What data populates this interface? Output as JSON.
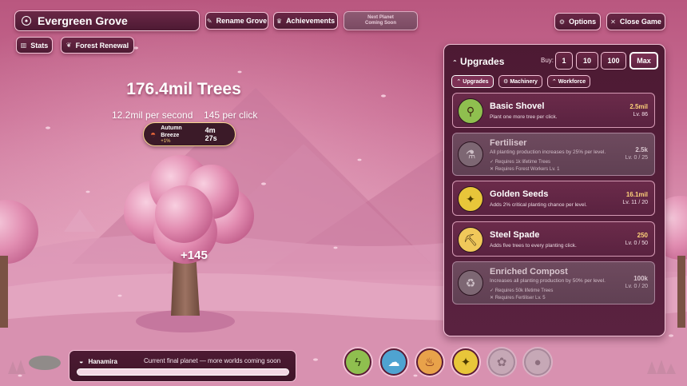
{
  "header": {
    "grove_name": "Evergreen Grove",
    "rename_label": "Rename Grove",
    "achievements_label": "Achievements",
    "next_planet_line1": "Next Planet",
    "next_planet_line2": "Coming Soon",
    "stats_label": "Stats",
    "renewal_label": "Forest Renewal",
    "options_label": "Options",
    "close_label": "Close Game"
  },
  "main": {
    "tree_count": "176.4mil Trees",
    "per_second": "12.2mil per second",
    "per_click": "145 per click",
    "click_popup": "+145"
  },
  "event": {
    "name": "Autumn Breeze",
    "bonus": "+1%",
    "timer": "4m 27s"
  },
  "upgrades_panel": {
    "title": "Upgrades",
    "buy_label": "Buy:",
    "buy_options": [
      "1",
      "10",
      "100",
      "Max"
    ],
    "selected_buy": "Max",
    "tabs": [
      "Upgrades",
      "Machinery",
      "Workforce"
    ],
    "active_tab": "Upgrades",
    "items": [
      {
        "name": "Basic Shovel",
        "desc": "Plant one more tree per click.",
        "cost": "2.5mil",
        "level": "Lv. 86",
        "locked": false,
        "icon": "shovel-icon",
        "icon_color": "#8fbf4f"
      },
      {
        "name": "Fertiliser",
        "desc": "All planting production increases by 25% per level.",
        "req1": "✓ Requires 1k lifetime Trees",
        "req2": "✕ Requires Forest Workers Lv. 1",
        "cost": "2.5k",
        "level": "Lv. 0 / 25",
        "locked": true,
        "icon": "test-tube-icon"
      },
      {
        "name": "Golden Seeds",
        "desc": "Adds 2% critical planting chance per level.",
        "cost": "16.1mil",
        "level": "Lv. 11 / 20",
        "locked": false,
        "icon": "sparkle-icon",
        "icon_color": "#e8c63a"
      },
      {
        "name": "Steel Spade",
        "desc": "Adds five trees to every planting click.",
        "cost": "250",
        "level": "Lv. 0 / 50",
        "locked": false,
        "icon": "pickaxe-icon",
        "icon_color": "#f0c85a"
      },
      {
        "name": "Enriched Compost",
        "desc": "Increases all planting production by 50% per level.",
        "req1": "✓ Requires 50k lifetime Trees",
        "req2": "✕ Requires Fertiliser Lv. 5",
        "cost": "100k",
        "level": "Lv. 0 / 20",
        "locked": true,
        "icon": "recycle-icon"
      }
    ]
  },
  "planet_bar": {
    "planet": "Hanamira",
    "message": "Current final planet — more worlds coming soon",
    "progress": 1.0
  },
  "abilities": [
    {
      "icon": "lightning-icon",
      "color": "#8fbf4f",
      "active": true
    },
    {
      "icon": "storm-cloud-icon",
      "color": "#4fa3d1",
      "active": true
    },
    {
      "icon": "horn-icon",
      "color": "#e8a24a",
      "active": true
    },
    {
      "icon": "sparkle-icon",
      "color": "#e8c63a",
      "active": true
    },
    {
      "icon": "rose-icon",
      "color": "#c6a8b6",
      "active": false
    },
    {
      "icon": "rock-icon",
      "color": "#c6a8b6",
      "active": false
    }
  ],
  "colors": {
    "panel_bg": "#4d1a33",
    "accent_border": "#f2c2d6",
    "gold_text": "#ffd27a"
  }
}
